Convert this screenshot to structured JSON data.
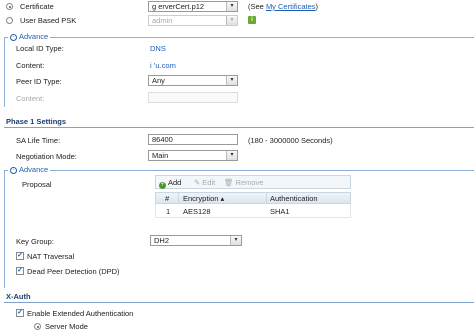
{
  "auth": {
    "certificate_label": "Certificate",
    "certificate_value": "g          erverCert.p12",
    "see_prefix": "(See ",
    "my_certificates_link": "My Certificates",
    "see_suffix": ")",
    "psk_label": "User Based PSK",
    "psk_value": "admin"
  },
  "advance1": {
    "legend": "Advance",
    "local_id_type_label": "Local ID Type:",
    "local_id_type_value": "DNS",
    "content_label": "Content:",
    "content_value": "i          ’u.com",
    "peer_id_type_label": "Peer ID Type:",
    "peer_id_type_value": "Any",
    "peer_content_label": "Content:"
  },
  "phase1": {
    "title": "Phase 1 Settings",
    "sa_life_label": "SA Life Time:",
    "sa_life_value": "86400",
    "sa_life_range": "(180 - 3000000 Seconds)",
    "neg_mode_label": "Negotiation Mode:",
    "neg_mode_value": "Main"
  },
  "advance2": {
    "legend": "Advance",
    "proposal_label": "Proposal",
    "toolbar": {
      "add": "Add",
      "edit": "Edit",
      "remove": "Remove"
    },
    "columns": [
      "#",
      "Encryption",
      "Authentication"
    ],
    "sort_arrow": "▴",
    "rows": [
      {
        "num": "1",
        "encryption": "AES128",
        "authentication": "SHA1"
      }
    ],
    "key_group_label": "Key Group:",
    "key_group_value": "DH2",
    "nat_traversal_label": "NAT Traversal",
    "dpd_label": "Dead Peer Detection (DPD)"
  },
  "xauth": {
    "title": "X-Auth",
    "enable_label": "Enable Extended Authentication",
    "server_mode_label": "Server Mode"
  }
}
